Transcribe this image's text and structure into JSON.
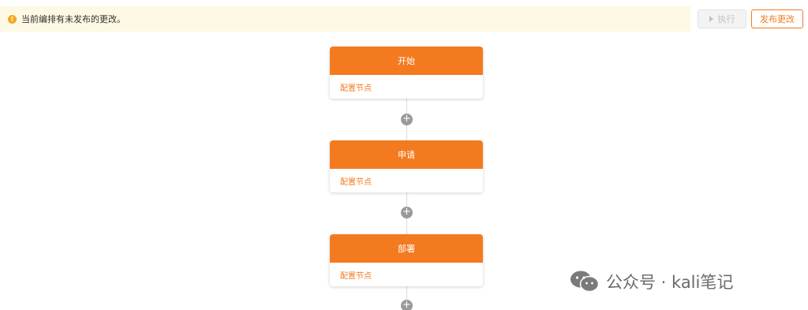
{
  "notice": {
    "icon": "warning-icon",
    "text": "当前编排有未发布的更改。"
  },
  "toolbar": {
    "run_label": "执行",
    "publish_label": "发布更改"
  },
  "nodes": [
    {
      "title": "开始",
      "config_label": "配置节点"
    },
    {
      "title": "申请",
      "config_label": "配置节点"
    },
    {
      "title": "部署",
      "config_label": "配置节点"
    }
  ],
  "add_symbol": "+",
  "watermark": {
    "icon": "wechat-icon",
    "text": "公众号 · kali笔记"
  },
  "colors": {
    "accent": "#f47a20",
    "notice_bg": "#fdf9e4",
    "warning": "#f5a623"
  }
}
